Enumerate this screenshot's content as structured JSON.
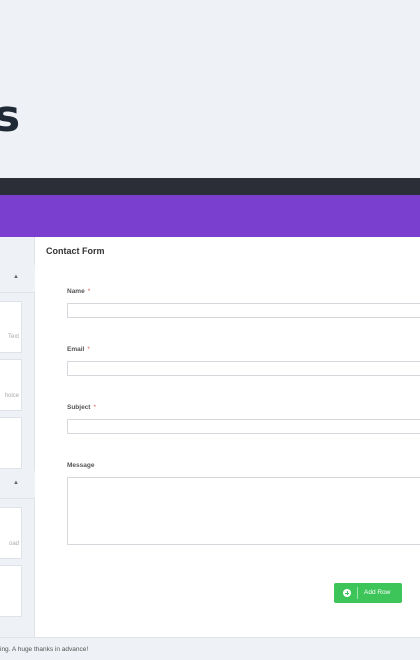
{
  "hero": {
    "title": "s"
  },
  "sidebar": {
    "cards": [
      {
        "label": "Text"
      },
      {
        "label": "hoice"
      },
      {
        "label": ""
      },
      {
        "label": "oad"
      },
      {
        "label": ""
      }
    ]
  },
  "form": {
    "title": "Contact Form",
    "fields": [
      {
        "label": "Name",
        "required": "*"
      },
      {
        "label": "Email",
        "required": "*"
      },
      {
        "label": "Subject",
        "required": "*"
      }
    ],
    "message_label": "Message",
    "add_row_label": "Add Row"
  },
  "footer": {
    "text": "ing. A huge thanks in advance!"
  },
  "colors": {
    "accent": "#7b3fd0",
    "button": "#3ec55a",
    "dark": "#2b2e37"
  }
}
